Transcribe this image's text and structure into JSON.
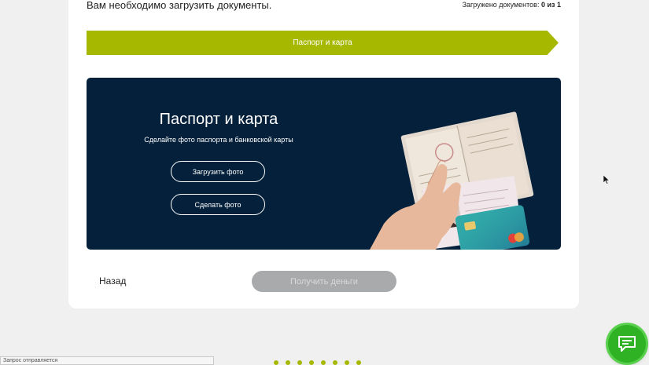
{
  "header": {
    "title": "Вам необходимо загрузить документы.",
    "counter_prefix": "Загружено документов: ",
    "counter_value": "0 из 1"
  },
  "step": {
    "label": "Паспорт и карта"
  },
  "upload_panel": {
    "title": "Паспорт и карта",
    "subtitle": "Сделайте фото паспорта и банковской карты",
    "upload_button": "Загрузить фото",
    "take_photo_button": "Сделать фото",
    "illustration_icon": "passport-card-hand-illustration"
  },
  "footer": {
    "back_label": "Назад",
    "submit_label": "Получить деньги"
  },
  "status_bar": {
    "text": "Запрос отправляется"
  },
  "loader": {
    "dot_count": 8,
    "color": "#a6b800"
  },
  "chat_widget": {
    "icon": "chat-icon",
    "color": "#2fb325"
  },
  "colors": {
    "accent": "#a6b800",
    "panel_bg": "#04203a",
    "disabled_button": "#a9aaac"
  }
}
